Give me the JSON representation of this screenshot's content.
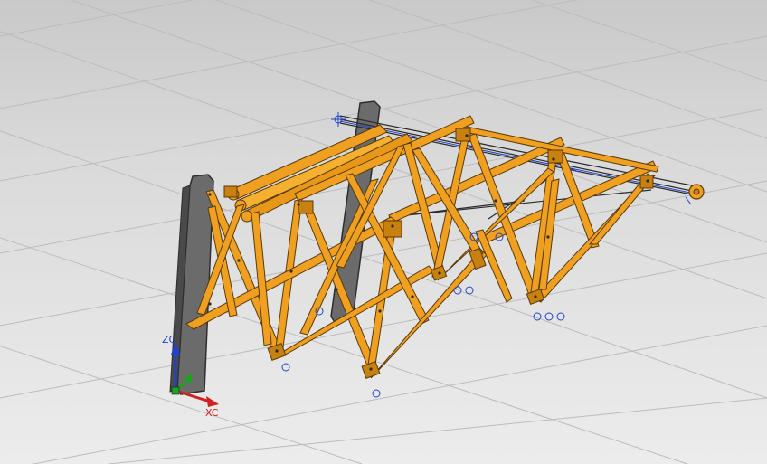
{
  "viewport": {
    "background_top": "#c9c9c9",
    "background_bottom": "#ececec",
    "grid_color": "#bcbcbc"
  },
  "model": {
    "truss_color": "#f0a020",
    "truss_edge_color": "#5a3a08",
    "column_color": "#6b6b6b",
    "cable_color": "#2a2a2a",
    "constraint_color": "#2244cc"
  },
  "wcs": {
    "x_label": "XC",
    "z_label": "ZC",
    "y_label": "",
    "x_color": "#d02020",
    "y_color": "#20a020",
    "z_color": "#2040d0"
  }
}
